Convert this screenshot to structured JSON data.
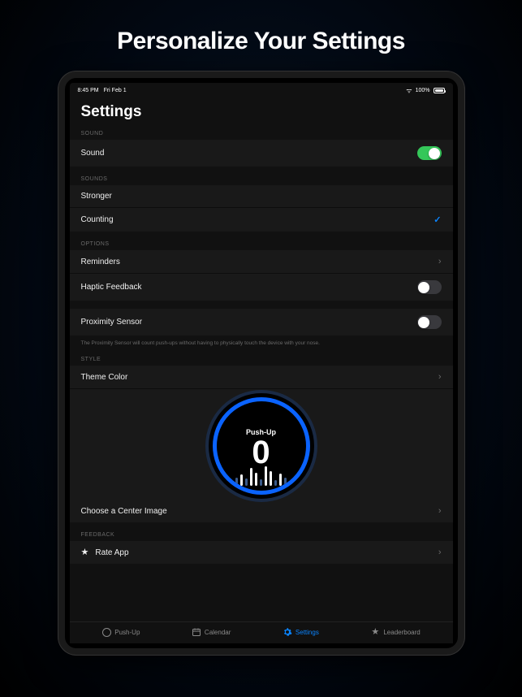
{
  "hero": {
    "title": "Personalize Your Settings"
  },
  "statusbar": {
    "time": "8:45 PM",
    "date": "Fri Feb 1",
    "battery_pct": "100%"
  },
  "page": {
    "title": "Settings"
  },
  "sections": {
    "sound": {
      "header": "SOUND",
      "row_label": "Sound",
      "toggle_on": true
    },
    "sounds": {
      "header": "SOUNDS",
      "items": [
        {
          "label": "Stronger",
          "selected": false
        },
        {
          "label": "Counting",
          "selected": true
        }
      ]
    },
    "options": {
      "header": "OPTIONS",
      "reminders_label": "Reminders",
      "haptic_label": "Haptic Feedback",
      "haptic_on": false,
      "proximity_label": "Proximity Sensor",
      "proximity_on": false,
      "proximity_note": "The Proximity Sensor will count push-ups without having to physically touch the device with your nose."
    },
    "style": {
      "header": "STYLE",
      "theme_label": "Theme Color",
      "widget_label": "Push-Up",
      "widget_count": "0",
      "center_image_label": "Choose a Center Image"
    },
    "feedback": {
      "header": "FEEDBACK",
      "rate_label": "Rate App"
    }
  },
  "tabbar": {
    "items": [
      {
        "label": "Push-Up",
        "icon": "ring-icon",
        "active": false
      },
      {
        "label": "Calendar",
        "icon": "calendar-icon",
        "active": false
      },
      {
        "label": "Settings",
        "icon": "gear-icon",
        "active": true
      },
      {
        "label": "Leaderboard",
        "icon": "star-icon",
        "active": false
      }
    ]
  },
  "colors": {
    "accent": "#0a84ff",
    "toggle_on": "#34c759"
  }
}
